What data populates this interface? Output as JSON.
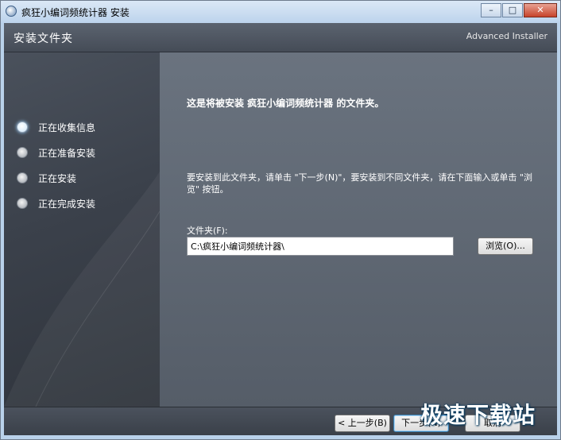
{
  "window": {
    "title": "疯狂小编词频统计器 安装",
    "min_icon": "minimize-icon",
    "max_icon": "maximize-icon",
    "close_icon": "close-icon"
  },
  "header": {
    "title": "安装文件夹",
    "brand": "Advanced Installer"
  },
  "steps": [
    {
      "label": "正在收集信息",
      "active": true
    },
    {
      "label": "正在准备安装",
      "active": false
    },
    {
      "label": "正在安装",
      "active": false
    },
    {
      "label": "正在完成安装",
      "active": false
    }
  ],
  "main": {
    "heading": "这是将被安装 疯狂小编词频统计器 的文件夹。",
    "description": "要安装到此文件夹，请单击 \"下一步(N)\"，要安装到不同文件夹，请在下面输入或单击 \"浏览\" 按钮。",
    "folder_label": "文件夹(F):",
    "folder_value": "C:\\疯狂小编词频统计器\\",
    "browse_label": "浏览(O)..."
  },
  "footer": {
    "back_label": "< 上一步(B)",
    "next_label": "下一步(N)",
    "cancel_label": "取消"
  },
  "watermark": "极速下载站"
}
